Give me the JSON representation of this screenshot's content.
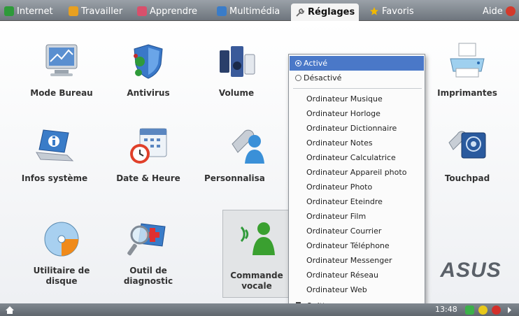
{
  "tabs": [
    {
      "label": "Internet",
      "color": "#2e9a3a"
    },
    {
      "label": "Travailler",
      "color": "#e8a020"
    },
    {
      "label": "Apprendre",
      "color": "#d8506c"
    },
    {
      "label": "Multimédia",
      "color": "#3a7cc8"
    },
    {
      "label": "Réglages",
      "color": "#888888"
    },
    {
      "label": "Favoris",
      "color": "#f0b800"
    }
  ],
  "help_label": "Aide",
  "apps": [
    {
      "label": "Mode Bureau",
      "icon": "monitor-icon"
    },
    {
      "label": "Antivirus",
      "icon": "shield-icon"
    },
    {
      "label": "Volume",
      "icon": "volume-icon"
    },
    {
      "label": "Imprimantes",
      "icon": "printer-icon"
    },
    {
      "label": "Infos système",
      "icon": "laptop-info-icon"
    },
    {
      "label": "Date & Heure",
      "icon": "calendar-clock-icon"
    },
    {
      "label": "Personnalisa",
      "icon": "wrench-user-icon"
    },
    {
      "label": "Touchpad",
      "icon": "touchpad-icon"
    },
    {
      "label": "Utilitaire de disque",
      "icon": "disk-pie-icon"
    },
    {
      "label": "Outil de diagnostic",
      "icon": "diagnostic-icon"
    },
    {
      "label": "Commande vocale",
      "icon": "voice-command-icon"
    }
  ],
  "menu": {
    "active_label": "Activé",
    "inactive_label": "Désactivé",
    "items": [
      "Ordinateur Musique",
      "Ordinateur Horloge",
      "Ordinateur Dictionnaire",
      "Ordinateur Notes",
      "Ordinateur Calculatrice",
      "Ordinateur Appareil photo",
      "Ordinateur Photo",
      "Ordinateur Eteindre",
      "Ordinateur Film",
      "Ordinateur Courrier",
      "Ordinateur Téléphone",
      "Ordinateur Messenger",
      "Ordinateur Réseau",
      "Ordinateur Web"
    ],
    "quit_label": "Quitter"
  },
  "taskbar": {
    "clock": "13:48"
  },
  "brand": "ASUS"
}
